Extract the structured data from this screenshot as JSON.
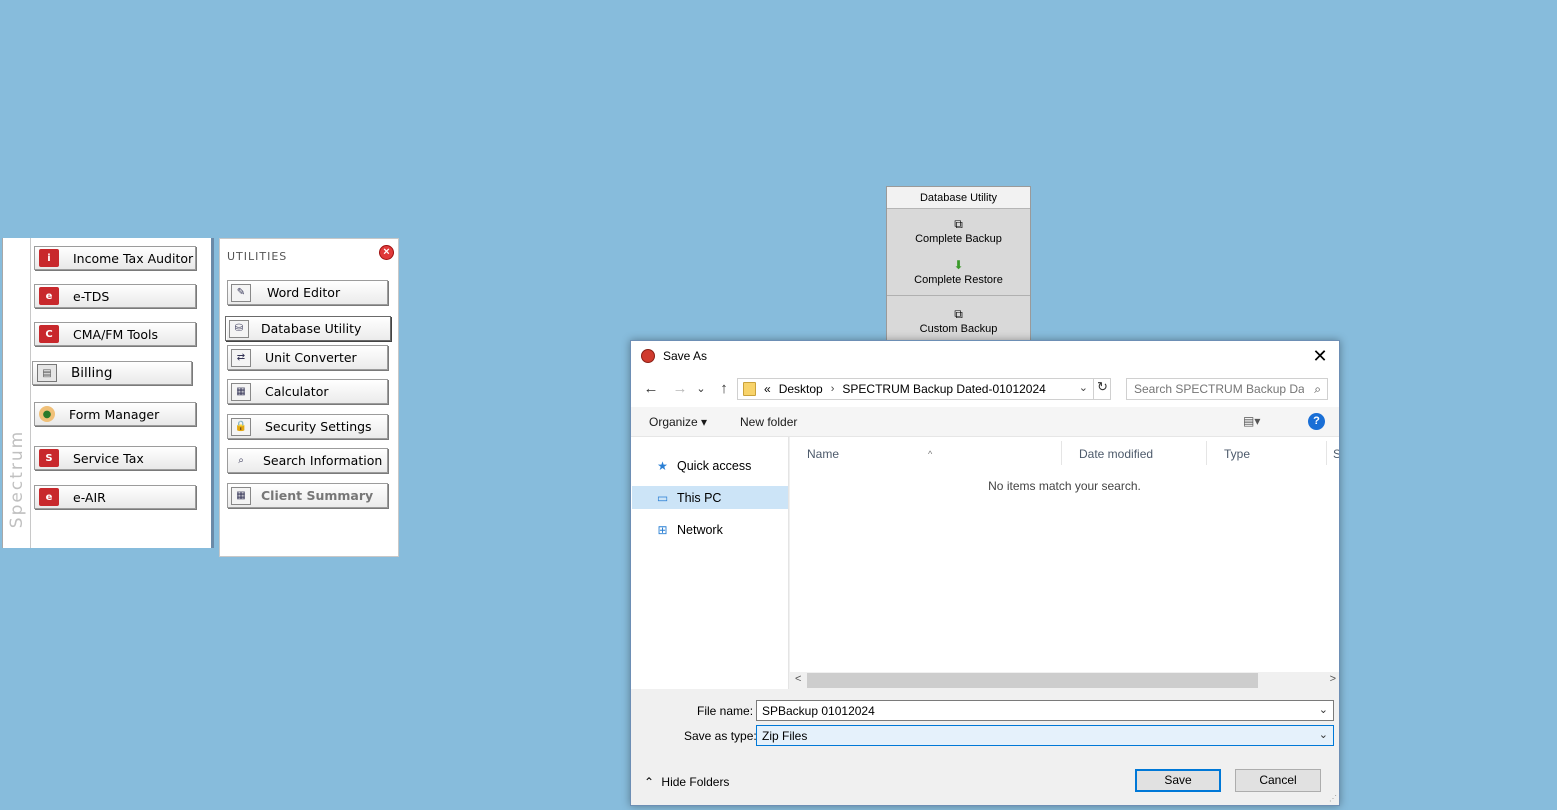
{
  "spectrum_panel": {
    "vertical_label": "Spectrum",
    "apps": [
      {
        "label": "Income Tax Auditor",
        "icon": "income-tax-icon",
        "glyph": "i"
      },
      {
        "label": "e-TDS",
        "icon": "etds-icon",
        "glyph": "e"
      },
      {
        "label": "CMA/FM Tools",
        "icon": "cma-icon",
        "glyph": "C"
      },
      {
        "label": "Billing",
        "icon": "billing-book-icon",
        "glyph": "▤"
      },
      {
        "label": "Form Manager",
        "icon": "form-manager-person-icon",
        "glyph": "●"
      },
      {
        "label": "Service Tax",
        "icon": "service-tax-icon",
        "glyph": "S"
      },
      {
        "label": "e-AIR",
        "icon": "eair-icon",
        "glyph": "e"
      }
    ]
  },
  "utilities_panel": {
    "title": "UTILITIES",
    "close_glyph": "×",
    "items": [
      {
        "label": "Word Editor",
        "icon": "word-editor-icon",
        "glyph": "✎"
      },
      {
        "label": "Database Utility",
        "icon": "database-icon",
        "glyph": "⛁"
      },
      {
        "label": "Unit Converter",
        "icon": "unit-converter-icon",
        "glyph": "⇄"
      },
      {
        "label": "Calculator",
        "icon": "calculator-icon",
        "glyph": "▦"
      },
      {
        "label": "Security Settings",
        "icon": "lock-icon",
        "glyph": "🔒"
      },
      {
        "label": "Search Information",
        "icon": "magnifier-icon",
        "glyph": "⌕"
      },
      {
        "label": "Client Summary",
        "icon": "client-summary-icon",
        "glyph": "▦"
      }
    ]
  },
  "db_popup": {
    "title": "Database Utility",
    "items": [
      {
        "label": "Complete Backup",
        "icon": "copy-icon",
        "glyph": "⧉"
      },
      {
        "label": "Complete Restore",
        "icon": "restore-icon",
        "glyph": "⬇"
      },
      {
        "label": "Custom Backup",
        "icon": "copy-icon",
        "glyph": "⧉"
      }
    ]
  },
  "dialog": {
    "title": "Save As",
    "close_glyph": "✕",
    "nav": {
      "back": "←",
      "forward": "→",
      "recent": "⌄",
      "up": "↑",
      "refresh": "↻"
    },
    "breadcrumb": {
      "overflow": "«",
      "items": [
        "Desktop",
        "SPECTRUM Backup Dated-01012024"
      ],
      "sep": "›",
      "dropdown": "⌄"
    },
    "search": {
      "placeholder": "Search SPECTRUM Backup Da...",
      "icon": "⌕"
    },
    "commands": {
      "organize": "Organize ▾",
      "new_folder": "New folder",
      "view": "▤▾",
      "help": "?"
    },
    "nav_pane": [
      {
        "label": "Quick access",
        "icon": "star-icon",
        "glyph": "★",
        "color": "#2a7fd4"
      },
      {
        "label": "This PC",
        "icon": "computer-icon",
        "glyph": "▭",
        "color": "#2a7fd4"
      },
      {
        "label": "Network",
        "icon": "network-icon",
        "glyph": "⊞",
        "color": "#2a7fd4"
      }
    ],
    "selected_nav": "This PC",
    "columns": [
      "Name",
      "Date modified",
      "Type",
      "S"
    ],
    "sort_caret": "^",
    "empty_message": "No items match your search.",
    "scroll": {
      "left": "<",
      "right": ">"
    },
    "file_name_label": "File name:",
    "file_name_value": "SPBackup 01012024",
    "save_type_label": "Save as type:",
    "save_type_value": "Zip Files",
    "hide_folders": "Hide Folders",
    "hide_caret": "⌃",
    "save_label": "Save",
    "cancel_label": "Cancel"
  },
  "colors": {
    "desktop": "#87bcdc",
    "accent": "#0078d7",
    "brand_red": "#c8282c"
  }
}
